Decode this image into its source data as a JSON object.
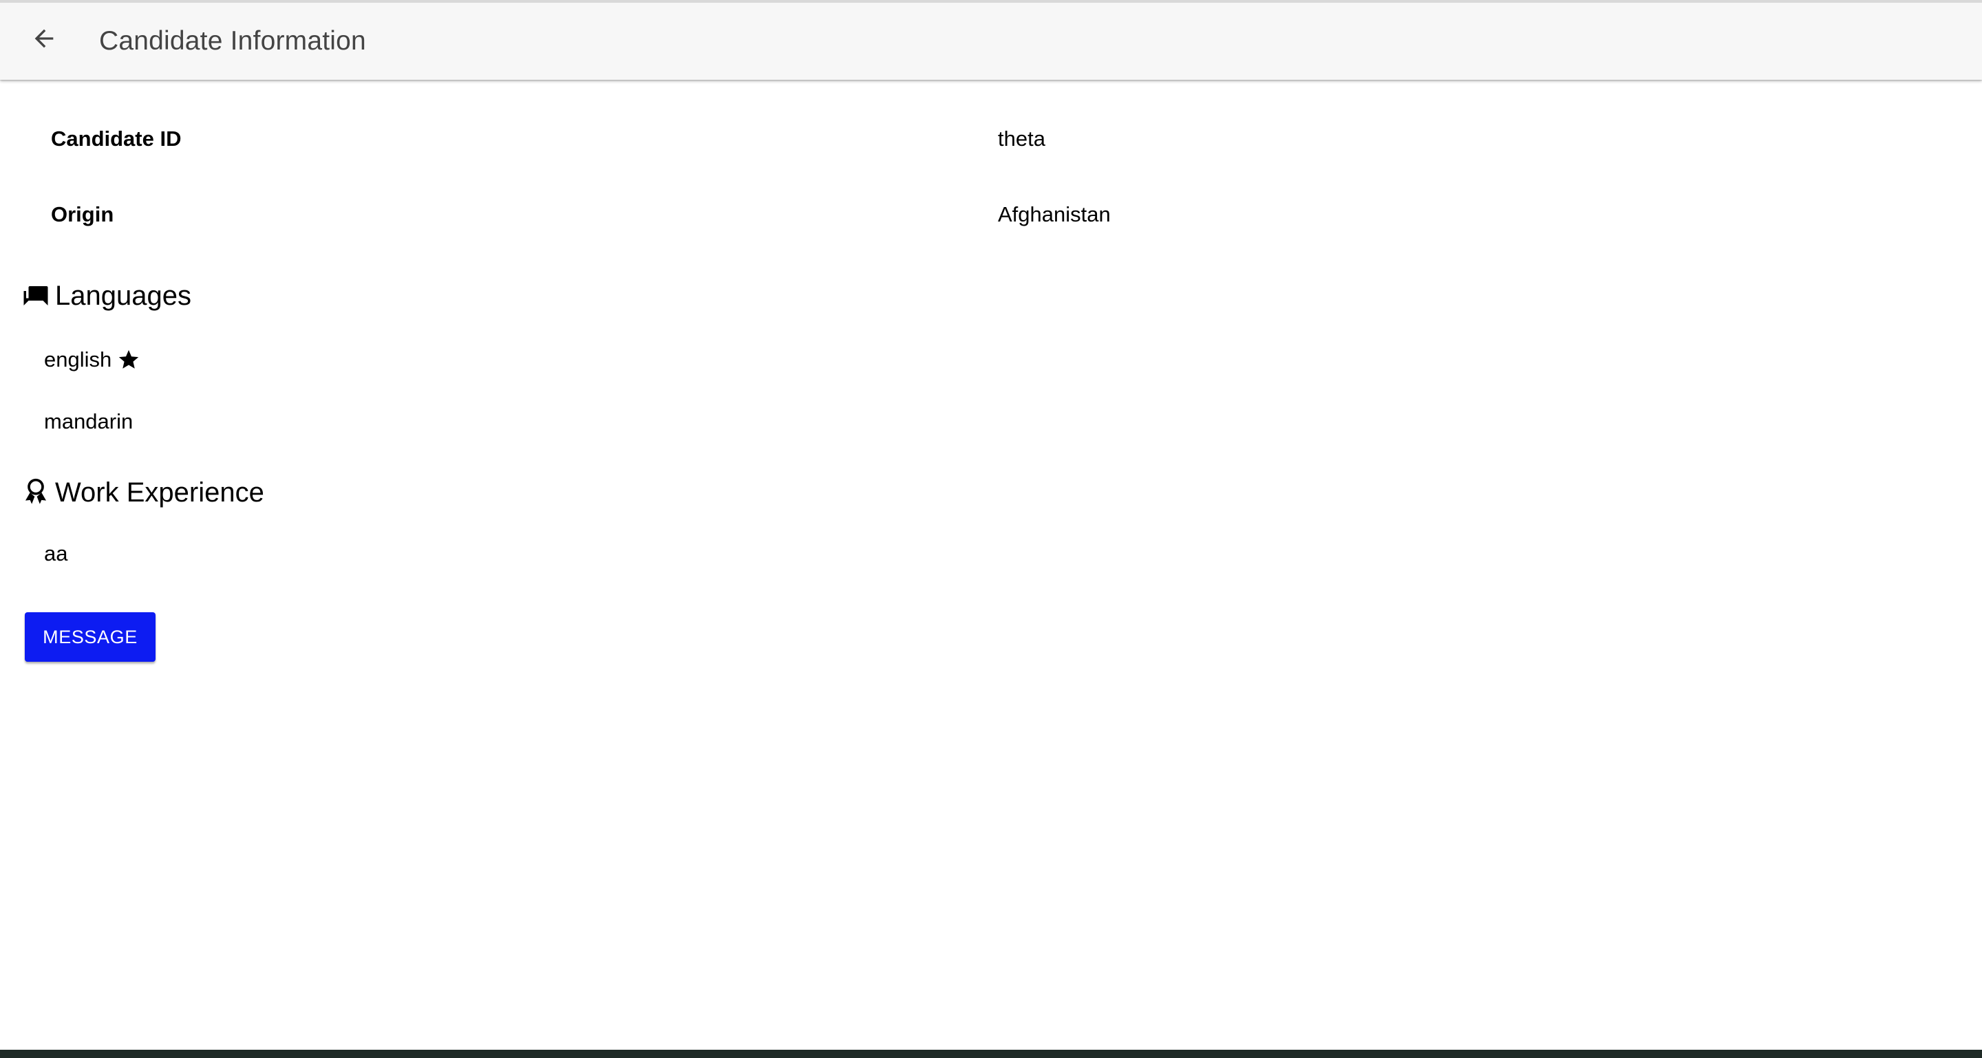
{
  "colors": {
    "topbar_bg": "#f7f7f7",
    "title_text": "#444444",
    "primary_button": "#0d1cf2",
    "button_text": "#ffffff"
  },
  "header": {
    "back_icon": "arrow-back-icon",
    "title": "Candidate Information"
  },
  "candidate": {
    "id_label": "Candidate ID",
    "id_value": "theta",
    "origin_label": "Origin",
    "origin_value": "Afghanistan"
  },
  "languages": {
    "icon": "chat-bubbles-icon",
    "heading": "Languages",
    "items": [
      {
        "name": "english",
        "primary": true,
        "badge_icon": "star-icon"
      },
      {
        "name": "mandarin",
        "primary": false
      }
    ]
  },
  "work_experience": {
    "icon": "award-icon",
    "heading": "Work Experience",
    "items": [
      {
        "text": "aa"
      }
    ]
  },
  "actions": {
    "message_label": "MESSAGE"
  }
}
